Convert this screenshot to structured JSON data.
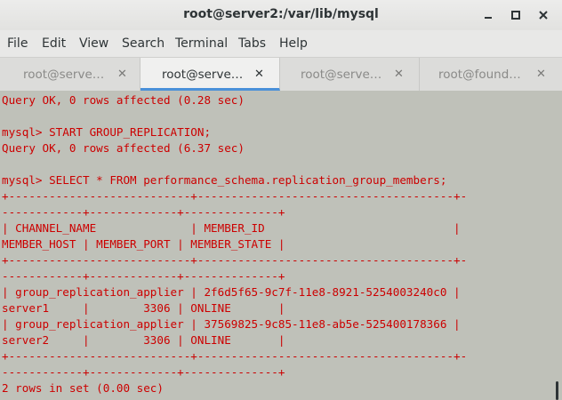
{
  "window": {
    "title": "root@server2:/var/lib/mysql",
    "controls": [
      "minimize-icon",
      "maximize-icon",
      "close-icon"
    ]
  },
  "menu": {
    "items": [
      "File",
      "Edit",
      "View",
      "Search",
      "Terminal",
      "Tabs",
      "Help"
    ]
  },
  "tabs": [
    {
      "label": "root@serve…",
      "active": false
    },
    {
      "label": "root@serve…",
      "active": true
    },
    {
      "label": "root@serve…",
      "active": false
    },
    {
      "label": "root@found…",
      "active": false
    }
  ],
  "terminal": {
    "text_color": "#cc0000",
    "background": "#bfc1b9",
    "lines": [
      "Query OK, 0 rows affected (0.28 sec)",
      "",
      "mysql> START GROUP_REPLICATION;",
      "Query OK, 0 rows affected (6.37 sec)",
      "",
      "mysql> SELECT * FROM performance_schema.replication_group_members;",
      "+---------------------------+--------------------------------------+-",
      "------------+-------------+--------------+",
      "| CHANNEL_NAME              | MEMBER_ID                            |",
      "MEMBER_HOST | MEMBER_PORT | MEMBER_STATE |",
      "+---------------------------+--------------------------------------+-",
      "------------+-------------+--------------+",
      "| group_replication_applier | 2f6d5f65-9c7f-11e8-8921-5254003240c0 |",
      "server1     |        3306 | ONLINE       |",
      "| group_replication_applier | 37569825-9c85-11e8-ab5e-525400178366 |",
      "server2     |        3306 | ONLINE       |",
      "+---------------------------+--------------------------------------+-",
      "------------+-------------+--------------+",
      "2 rows in set (0.00 sec)"
    ]
  }
}
